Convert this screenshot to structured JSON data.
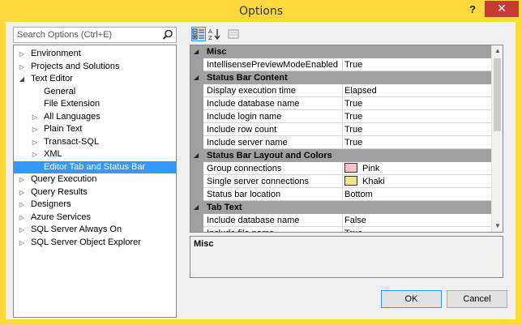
{
  "window": {
    "title": "Options",
    "help_label": "?",
    "close_label": "✕"
  },
  "search": {
    "placeholder": "Search Options (Ctrl+E)"
  },
  "tree": [
    {
      "label": "Environment",
      "level": 0,
      "expander": "collapsed"
    },
    {
      "label": "Projects and Solutions",
      "level": 0,
      "expander": "collapsed"
    },
    {
      "label": "Text Editor",
      "level": 0,
      "expander": "expanded"
    },
    {
      "label": "General",
      "level": 1,
      "expander": "none"
    },
    {
      "label": "File Extension",
      "level": 1,
      "expander": "none"
    },
    {
      "label": "All Languages",
      "level": 1,
      "expander": "collapsed"
    },
    {
      "label": "Plain Text",
      "level": 1,
      "expander": "collapsed"
    },
    {
      "label": "Transact-SQL",
      "level": 1,
      "expander": "collapsed"
    },
    {
      "label": "XML",
      "level": 1,
      "expander": "collapsed"
    },
    {
      "label": "Editor Tab and Status Bar",
      "level": 1,
      "expander": "none",
      "selected": true
    },
    {
      "label": "Query Execution",
      "level": 0,
      "expander": "collapsed"
    },
    {
      "label": "Query Results",
      "level": 0,
      "expander": "collapsed"
    },
    {
      "label": "Designers",
      "level": 0,
      "expander": "collapsed"
    },
    {
      "label": "Azure Services",
      "level": 0,
      "expander": "collapsed"
    },
    {
      "label": "SQL Server Always On",
      "level": 0,
      "expander": "collapsed"
    },
    {
      "label": "SQL Server Object Explorer",
      "level": 0,
      "expander": "collapsed"
    }
  ],
  "toolbar": {
    "categorized_icon": "categorized-icon",
    "alphabetical_icon": "alphabetical-sort-icon",
    "property_pages_icon": "property-pages-icon"
  },
  "grid": [
    {
      "type": "category",
      "label": "Misc"
    },
    {
      "type": "property",
      "name": "IntellisensePreviewModeEnabled",
      "value": "True"
    },
    {
      "type": "category",
      "label": "Status Bar Content"
    },
    {
      "type": "property",
      "name": "Display execution time",
      "value": "Elapsed"
    },
    {
      "type": "property",
      "name": "Include database name",
      "value": "True"
    },
    {
      "type": "property",
      "name": "Include login name",
      "value": "True"
    },
    {
      "type": "property",
      "name": "Include row count",
      "value": "True"
    },
    {
      "type": "property",
      "name": "Include server name",
      "value": "True"
    },
    {
      "type": "category",
      "label": "Status Bar Layout and Colors"
    },
    {
      "type": "property",
      "name": "Group connections",
      "value": "Pink",
      "swatch": "#f7c1c8"
    },
    {
      "type": "property",
      "name": "Single server connections",
      "value": "Khaki",
      "swatch": "#f0e68c"
    },
    {
      "type": "property",
      "name": "Status bar location",
      "value": "Bottom"
    },
    {
      "type": "category",
      "label": "Tab Text"
    },
    {
      "type": "property",
      "name": "Include database name",
      "value": "False"
    },
    {
      "type": "property",
      "name": "Include file name",
      "value": "True"
    }
  ],
  "description": {
    "title": "Misc"
  },
  "buttons": {
    "ok": "OK",
    "cancel": "Cancel"
  }
}
